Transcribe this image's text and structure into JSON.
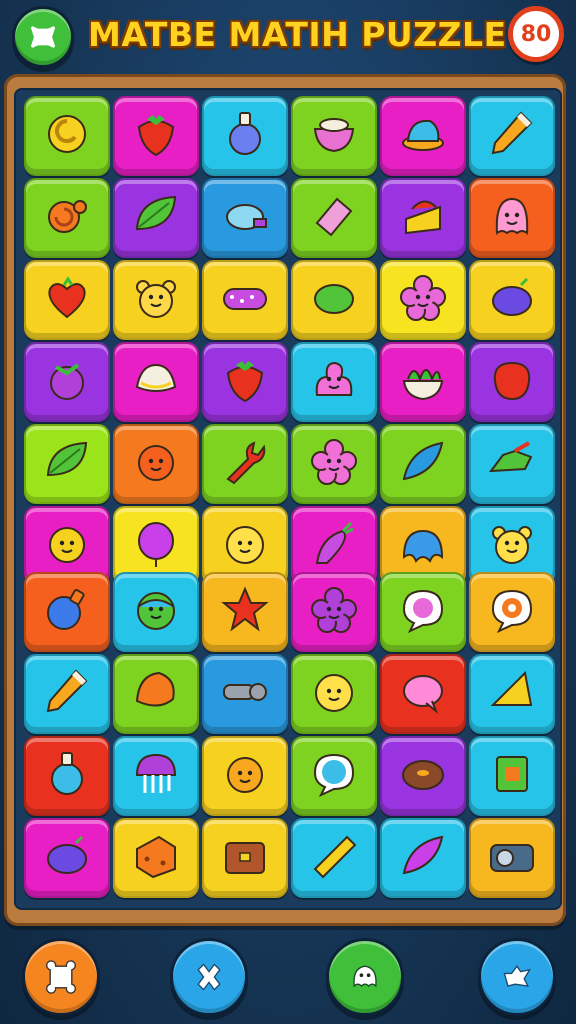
{
  "header": {
    "title": "MATBE MATIH PUZZLE",
    "score": "80",
    "menu_icon": "menu-icon"
  },
  "colors": {
    "green": "#7ed321",
    "magenta": "#e81fc4",
    "cyan": "#27c4ea",
    "lime": "#9be31a",
    "purple": "#9a34e0",
    "orange": "#f57a1f",
    "yellow": "#f7d11f",
    "red": "#e8321f",
    "blue": "#2a9ae0",
    "pink": "#ff5ab0"
  },
  "grid_top": [
    [
      {
        "c": "#7ed321",
        "icon": "coin-icon",
        "ic": "#f7d11f"
      },
      {
        "c": "#e81fc4",
        "icon": "strawberry-icon",
        "ic": "#e8321f"
      },
      {
        "c": "#27c4ea",
        "icon": "potion-icon",
        "ic": "#6a7ff0"
      },
      {
        "c": "#7ed321",
        "icon": "bowl-icon",
        "ic": "#e870d0"
      },
      {
        "c": "#e81fc4",
        "icon": "hat-icon",
        "ic": "#3bbde8"
      },
      {
        "c": "#27c4ea",
        "icon": "pencil-icon",
        "ic": "#f7a81f"
      }
    ],
    [
      {
        "c": "#7ed321",
        "icon": "snail-icon",
        "ic": "#f57a1f"
      },
      {
        "c": "#9a34e0",
        "icon": "leaf-icon",
        "ic": "#52c43a"
      },
      {
        "c": "#2a9ae0",
        "icon": "pot-icon",
        "ic": "#8fd8f2"
      },
      {
        "c": "#7ed321",
        "icon": "eraser-icon",
        "ic": "#f0a0d8"
      },
      {
        "c": "#9a34e0",
        "icon": "cake-icon",
        "ic": "#f7d11f"
      },
      {
        "c": "#f5601f",
        "icon": "ghost-icon",
        "ic": "#ff9ad0"
      }
    ],
    [
      {
        "c": "#f7d11f",
        "icon": "heart-icon",
        "ic": "#e8321f"
      },
      {
        "c": "#f7d11f",
        "icon": "bear-icon",
        "ic": "#ffd84a"
      },
      {
        "c": "#f7d11f",
        "icon": "caterpillar-icon",
        "ic": "#c94ce0"
      },
      {
        "c": "#f7d11f",
        "icon": "bean-icon",
        "ic": "#52c43a"
      },
      {
        "c": "#f7e31f",
        "icon": "flower-icon",
        "ic": "#e86ad8"
      },
      {
        "c": "#f7d11f",
        "icon": "plum-icon",
        "ic": "#6a4ae0"
      }
    ],
    [
      {
        "c": "#9a34e0",
        "icon": "berry-icon",
        "ic": "#b040d8"
      },
      {
        "c": "#e81fc4",
        "icon": "dumpling-icon",
        "ic": "#f5efe0"
      },
      {
        "c": "#9a34e0",
        "icon": "strawberry-icon",
        "ic": "#e8321f"
      },
      {
        "c": "#27c4ea",
        "icon": "blob-icon",
        "ic": "#f070d8"
      },
      {
        "c": "#e81fc4",
        "icon": "salad-icon",
        "ic": "#f5efe0"
      },
      {
        "c": "#9a34e0",
        "icon": "rose-icon",
        "ic": "#e8321f"
      }
    ],
    [
      {
        "c": "#9be31a",
        "icon": "leaf-icon",
        "ic": "#52c43a"
      },
      {
        "c": "#f57a1f",
        "icon": "sun-face-icon",
        "ic": "#f5601f"
      },
      {
        "c": "#7ed321",
        "icon": "wrench-icon",
        "ic": "#e8321f"
      },
      {
        "c": "#7ed321",
        "icon": "flower-icon",
        "ic": "#f070d8"
      },
      {
        "c": "#7ed321",
        "icon": "feather-icon",
        "ic": "#2a9ae0"
      },
      {
        "c": "#27c4ea",
        "icon": "shoe-icon",
        "ic": "#52c43a"
      }
    ],
    [
      {
        "c": "#e81fc4",
        "icon": "sun-face-icon",
        "ic": "#f7d11f"
      },
      {
        "c": "#f7e31f",
        "icon": "balloon-icon",
        "ic": "#c940e8"
      },
      {
        "c": "#f7d11f",
        "icon": "smiley-icon",
        "ic": "#ffe04a"
      },
      {
        "c": "#e81fc4",
        "icon": "radish-icon",
        "ic": "#c94ce0"
      },
      {
        "c": "#f7b81f",
        "icon": "jelly-icon",
        "ic": "#3b9ae8"
      },
      {
        "c": "#27c4ea",
        "icon": "bear-icon",
        "ic": "#ffe04a"
      }
    ]
  ],
  "grid_bottom": [
    [
      {
        "c": "#f5601f",
        "icon": "bottle-icon",
        "ic": "#3b7ae8"
      },
      {
        "c": "#27c4ea",
        "icon": "alien-icon",
        "ic": "#52c43a"
      },
      {
        "c": "#f7b81f",
        "icon": "star-icon",
        "ic": "#e8321f"
      },
      {
        "c": "#e81fc4",
        "icon": "flower-icon",
        "ic": "#b040d8"
      },
      {
        "c": "#7ed321",
        "icon": "chat-icon",
        "ic": "#e86ad8"
      },
      {
        "c": "#f7b81f",
        "icon": "target-icon",
        "ic": "#f57a1f"
      }
    ],
    [
      {
        "c": "#27c4ea",
        "icon": "pencil-icon",
        "ic": "#f7a81f"
      },
      {
        "c": "#7ed321",
        "icon": "shell-icon",
        "ic": "#f57a1f"
      },
      {
        "c": "#2a9ae0",
        "icon": "key-icon",
        "ic": "#9aa3ad"
      },
      {
        "c": "#7ed321",
        "icon": "smiley-icon",
        "ic": "#ffe04a"
      },
      {
        "c": "#e8321f",
        "icon": "heart-bubble-icon",
        "ic": "#ff8ad8"
      },
      {
        "c": "#27c4ea",
        "icon": "cheese-icon",
        "ic": "#f7d11f"
      }
    ],
    [
      {
        "c": "#e8321f",
        "icon": "potion-icon",
        "ic": "#3bbde8"
      },
      {
        "c": "#27c4ea",
        "icon": "jellyfish-icon",
        "ic": "#b040d8"
      },
      {
        "c": "#f7d11f",
        "icon": "sun-face-icon",
        "ic": "#f7a81f"
      },
      {
        "c": "#7ed321",
        "icon": "globe-icon",
        "ic": "#3bbde8"
      },
      {
        "c": "#9a34e0",
        "icon": "donut-icon",
        "ic": "#8a4a2a"
      },
      {
        "c": "#27c4ea",
        "icon": "box-icon",
        "ic": "#52c43a"
      }
    ],
    [
      {
        "c": "#e81fc4",
        "icon": "plum-icon",
        "ic": "#6a4ae0"
      },
      {
        "c": "#f7d11f",
        "icon": "cheese-block-icon",
        "ic": "#f57a1f"
      },
      {
        "c": "#f7d11f",
        "icon": "chest-icon",
        "ic": "#b0562a"
      },
      {
        "c": "#27c4ea",
        "icon": "bread-icon",
        "ic": "#f7d11f"
      },
      {
        "c": "#27c4ea",
        "icon": "feather-icon",
        "ic": "#c940e8"
      },
      {
        "c": "#f7b81f",
        "icon": "camera-icon",
        "ic": "#4a6a8a"
      }
    ]
  ],
  "bottom_bar": [
    {
      "name": "bone-button",
      "icon": "bone-icon",
      "color": "#f5851f"
    },
    {
      "name": "shuffle-button",
      "icon": "cross-icon",
      "color": "#2aa6e8"
    },
    {
      "name": "hint-button",
      "icon": "ghost-icon",
      "color": "#3fbf3a"
    },
    {
      "name": "undo-button",
      "icon": "arrow-icon",
      "color": "#2aa6e8"
    }
  ]
}
